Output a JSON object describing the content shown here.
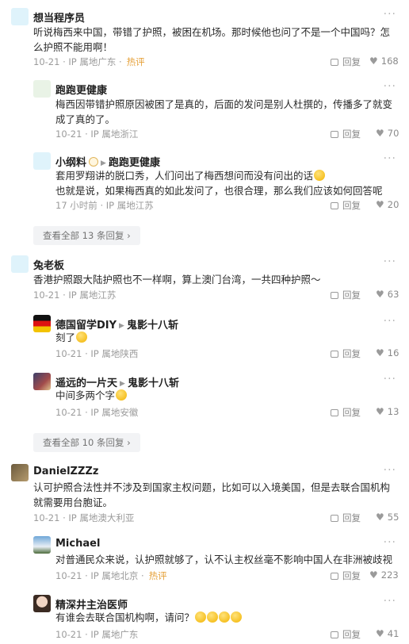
{
  "threads": [
    {
      "name": "想当程序员",
      "text": "听说梅西来中国，带错了护照，被困在机场。那时候他也问了不是一个中国吗？怎么护照不能用啊！",
      "meta": "10-21 · IP 属地广东 ·",
      "hot": "热评",
      "reply": "回复",
      "likes": "168",
      "replies": [
        {
          "name": "跑跑更健康",
          "to": "",
          "text": "梅西因带错护照原因被困了是真的，后面的发问是别人杜撰的，传播多了就变成了真的了。",
          "meta": "10-21 · IP 属地浙江",
          "reply": "回复",
          "likes": "70"
        },
        {
          "name": "小纲料",
          "to": "跑跑更健康",
          "text": "套用罗翔讲的脱口秀，人们问出了梅西想问而没有问出的话",
          "text2": "也就是说，如果梅西真的如此发问了，也很合理，那么我们应该如何回答呢",
          "meta": "17 小时前 · IP 属地江苏",
          "reply": "回复",
          "likes": "20"
        }
      ],
      "view_all": "查看全部 13 条回复 ›"
    },
    {
      "name": "兔老板",
      "text": "香港护照跟大陆护照也不一样啊，算上澳门台湾，一共四种护照～",
      "meta": "10-21 · IP 属地江苏",
      "reply": "回复",
      "likes": "63",
      "replies": [
        {
          "name": "德国留学DIY",
          "to": "鬼影十八斩",
          "text": "刻了",
          "meta": "10-21 · IP 属地陕西",
          "reply": "回复",
          "likes": "16"
        },
        {
          "name": "遥远的一片天",
          "to": "鬼影十八斩",
          "text": "中间多两个字",
          "meta": "10-21 · IP 属地安徽",
          "reply": "回复",
          "likes": "13"
        }
      ],
      "view_all": "查看全部 10 条回复 ›"
    },
    {
      "name": "DanielZZZz",
      "text": "认可护照合法性并不涉及到国家主权问题，比如可以入境美国，但是去联合国机构就需要用台胞证。",
      "meta": "10-21 · IP 属地澳大利亚",
      "reply": "回复",
      "likes": "55",
      "replies": [
        {
          "name": "Michael",
          "to": "",
          "text": "对普通民众来说，认护照就够了，认不认主权丝毫不影响中国人在非洲被歧视",
          "meta": "10-21 · IP 属地北京 ·",
          "hot": "热评",
          "reply": "回复",
          "likes": "223"
        },
        {
          "name": "精深井主治医师",
          "to": "",
          "text": "有谁会去联合国机构啊，请问？",
          "meta": "10-21 · IP 属地广东",
          "reply": "回复",
          "likes": "41"
        }
      ]
    }
  ],
  "icons": {
    "more": "more-dots-icon",
    "reply": "reply-bubble-icon",
    "like": "heart-icon",
    "emoji": "laughing-emoji-icon"
  }
}
